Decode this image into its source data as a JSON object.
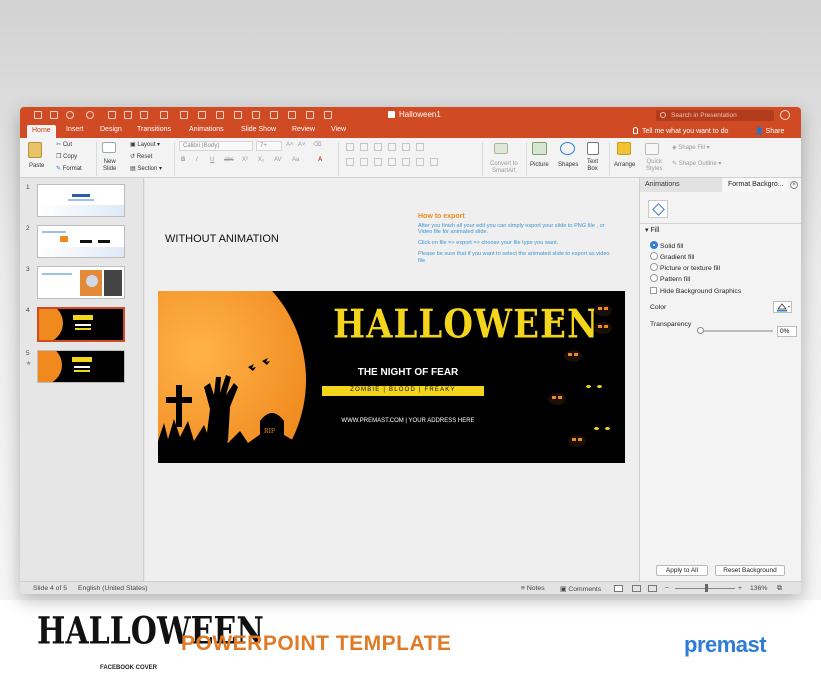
{
  "window": {
    "doc_title": "Halloween1",
    "search_placeholder": "Search in Presentation"
  },
  "tabs": [
    {
      "label": "Home",
      "active": true
    },
    {
      "label": "Insert"
    },
    {
      "label": "Design"
    },
    {
      "label": "Transitions"
    },
    {
      "label": "Animations"
    },
    {
      "label": "Slide Show"
    },
    {
      "label": "Review"
    },
    {
      "label": "View"
    }
  ],
  "tellme": "Tell me what you want to do",
  "share": "Share",
  "ribbon": {
    "paste": "Paste",
    "cut": "Cut",
    "copy": "Copy",
    "format": "Format",
    "new_slide": "New\nSlide",
    "layout": "Layout",
    "reset": "Reset",
    "section": "Section",
    "font_name": "Calibri (Body)",
    "font_size": "7+",
    "convert_smartart": "Convert to\nSmartArt",
    "picture": "Picture",
    "shapes": "Shapes",
    "text_box": "Text\nBox",
    "arrange": "Arrange",
    "quick_styles": "Quick\nStyles",
    "shape_fill": "Shape Fill",
    "shape_outline": "Shape Outline",
    "accent_color": "#d04a24"
  },
  "thumbnails": [
    {
      "num": "1"
    },
    {
      "num": "2"
    },
    {
      "num": "3"
    },
    {
      "num": "4",
      "selected": true
    },
    {
      "num": "5",
      "star": "★"
    }
  ],
  "slide": {
    "without_animation": "WITHOUT ANIMATION",
    "howto_title": "How to export",
    "howto_p1": "After you finish all your edit you can simply export your slide to PNG file , or Video file for animated slide.",
    "howto_p2": "Click on file => export => choose your file type you want.",
    "howto_p3": "Please be sure that if you want to select the animated slide to export as video file",
    "banner": {
      "title": "HALLOWEEN",
      "subtitle": "THE NIGHT OF FEAR",
      "tags": "ZOMBIE | BLOOD | FREAKY",
      "web": "WWW.PREMAST.COM | YOUR ADDRESS HERE",
      "tombstone": "RIP"
    }
  },
  "panel": {
    "tab_animations": "Animations",
    "tab_format": "Format Backgro...",
    "fill_header": "Fill",
    "options": [
      {
        "label": "Solid fill",
        "checked": true
      },
      {
        "label": "Gradient fill"
      },
      {
        "label": "Picture or texture fill"
      },
      {
        "label": "Pattern fill"
      }
    ],
    "hide_bg": "Hide Background Graphics",
    "color_label": "Color",
    "transparency_label": "Transparency",
    "transparency_value": "0%",
    "apply_all": "Apply to All",
    "reset_bg": "Reset Background"
  },
  "status": {
    "slide_of": "Slide 4 of 5",
    "language": "English (United States)",
    "notes": "Notes",
    "comments": "Comments",
    "zoom": "136%"
  },
  "footer": {
    "logo_text": "HALLOWEEN",
    "logo_sub": "FACEBOOK COVER",
    "title": "POWERPOINT TEMPLATE",
    "brand": "premast"
  }
}
